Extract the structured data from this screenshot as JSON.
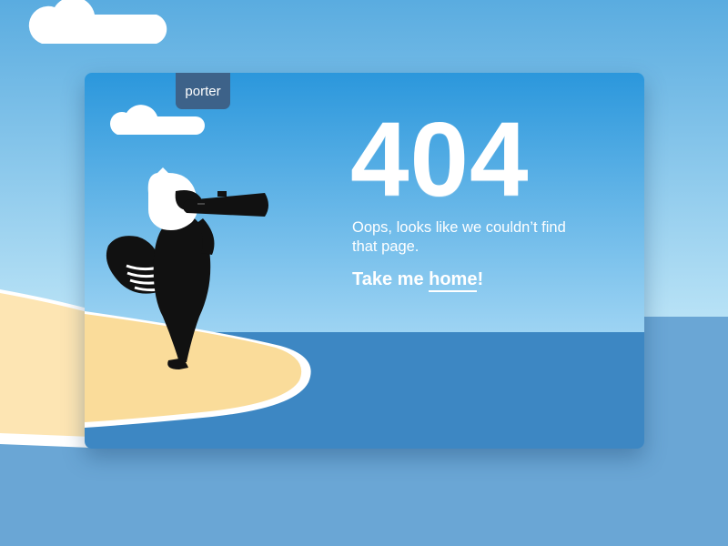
{
  "brand": {
    "name": "porter"
  },
  "error": {
    "code": "404",
    "message": "Oops, looks like we couldn’t find that page.",
    "cta_prefix": "Take me ",
    "cta_link": "home",
    "cta_suffix": "!"
  },
  "colors": {
    "sky_top": "#5aace0",
    "sky_bottom": "#b3e1f6",
    "sea": "#3d87c3",
    "sea_outer": "#6aa6d5",
    "sand": "#fadc9a",
    "tab": "#3d6289",
    "text": "#ffffff"
  },
  "icons": {
    "mascot": "raccoon-with-binoculars-icon",
    "cloud": "cloud-icon"
  }
}
